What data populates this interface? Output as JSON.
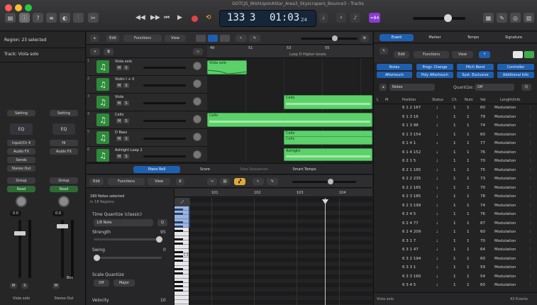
{
  "window": {
    "title": "GOTCJS_WishUponAStar_Area3_Skyscrapers_Bounce3 - Tracks"
  },
  "lcd": {
    "bar": "133",
    "beat": "3",
    "time": "01:03",
    "frames": "24"
  },
  "badge": "≈84",
  "inspector": {
    "region": "Region: 23 selected",
    "track": "Track: Viola solo",
    "strips": [
      {
        "setting": "Setting",
        "eq": "EQ",
        "input": "Input/Ch 4",
        "audiofx": "Audio FX",
        "sends": "Sends",
        "output": "Stereo Out",
        "group": "Group",
        "auto": "Read",
        "pan": "0.0",
        "name": "Viola solo"
      },
      {
        "setting": "Setting",
        "eq": "EQ",
        "input": "Hi",
        "audiofx": "Audio FX",
        "sends": "",
        "output": "",
        "group": "Group",
        "auto": "Read",
        "pan": "0.0",
        "name": "Stereo Out",
        "bnc": "Bnc"
      }
    ]
  },
  "tracks_area": {
    "menu": [
      "Edit",
      "Functions",
      "View"
    ],
    "ruler": [
      "49",
      "51",
      "53",
      "55"
    ],
    "marker": "Loop D Higher levels",
    "tracks": [
      {
        "num": "1",
        "name": "Viola solo"
      },
      {
        "num": "2",
        "name": "Violin I + II"
      },
      {
        "num": "3",
        "name": "Viola"
      },
      {
        "num": "4",
        "name": "Cello"
      },
      {
        "num": "5",
        "name": "D Bass"
      },
      {
        "num": "6",
        "name": "Ashlight Loop 2"
      }
    ],
    "regions": [
      {
        "label": "Viola solo"
      },
      {
        "label": "Cello"
      },
      {
        "label": "Cello"
      },
      {
        "label": "Cello"
      },
      {
        "label": "Cello"
      },
      {
        "label": "Ashlight"
      }
    ]
  },
  "editor_tabs": [
    "Piano Roll",
    "Score",
    "Step Sequencer",
    "Smart Tempo"
  ],
  "piano_roll": {
    "menu": [
      "Edit",
      "Functions",
      "View"
    ],
    "selected": "180 Notes selected",
    "subselected": "in 18 Regions",
    "time_quantize_label": "Time Quantize (classic)",
    "time_quantize_value": "1/8 Note",
    "strength_label": "Strength",
    "strength_value": "95",
    "swing_label": "Swing",
    "swing_value": "0",
    "scale_label": "Scale Quantize",
    "scale_off": "Off",
    "scale_major": "Major",
    "velocity_label": "Velocity",
    "velocity_value": "10",
    "ruler": [
      "101",
      "102",
      "103",
      "104"
    ],
    "key_label": "C3"
  },
  "event_list": {
    "tabs": [
      "Event",
      "Marker",
      "Tempo",
      "Signature"
    ],
    "menu": [
      "Edit",
      "Functions",
      "View"
    ],
    "filters": [
      "Notes",
      "Progr. Change",
      "Pitch Bend",
      "Controller",
      "Aftertouch",
      "Poly Aftertouch",
      "Syst. Exclusive",
      "Additional Info"
    ],
    "notes_label": "Notes",
    "quantize_label": "Quantize:",
    "quantize_value": "Off",
    "columns": [
      "L",
      "M",
      "Position",
      "Status",
      "Ch",
      "Num",
      "Val",
      "Length/Info"
    ],
    "rows": [
      {
        "pos": "6 1 2 167",
        "status": "♩",
        "ch": "1",
        "num": "1",
        "val": "60",
        "info": "Modulation"
      },
      {
        "pos": "6 1 3 16",
        "status": "♩",
        "ch": "1",
        "num": "1",
        "val": "79",
        "info": "Modulation"
      },
      {
        "pos": "6 1 3 98",
        "status": "♩",
        "ch": "1",
        "num": "1",
        "val": "74",
        "info": "Modulation"
      },
      {
        "pos": "6 1 3 154",
        "status": "♩",
        "ch": "1",
        "num": "1",
        "val": "60",
        "info": "Modulation"
      },
      {
        "pos": "6 1 4 1",
        "status": "♩",
        "ch": "1",
        "num": "1",
        "val": "77",
        "info": "Modulation"
      },
      {
        "pos": "6 1 4 152",
        "status": "♩",
        "ch": "1",
        "num": "1",
        "val": "76",
        "info": "Modulation"
      },
      {
        "pos": "6 2 1 5",
        "status": "♩",
        "ch": "1",
        "num": "1",
        "val": "70",
        "info": "Modulation"
      },
      {
        "pos": "6 2 1 165",
        "status": "♩",
        "ch": "1",
        "num": "1",
        "val": "75",
        "info": "Modulation"
      },
      {
        "pos": "6 2 2 235",
        "status": "♩",
        "ch": "1",
        "num": "1",
        "val": "73",
        "info": "Modulation"
      },
      {
        "pos": "6 2 2 165",
        "status": "♩",
        "ch": "1",
        "num": "1",
        "val": "70",
        "info": "Modulation"
      },
      {
        "pos": "6 2 3 185",
        "status": "♩",
        "ch": "1",
        "num": "1",
        "val": "78",
        "info": "Modulation"
      },
      {
        "pos": "6 2 3 199",
        "status": "♩",
        "ch": "1",
        "num": "1",
        "val": "74",
        "info": "Modulation"
      },
      {
        "pos": "6 2 4 5",
        "status": "♩",
        "ch": "1",
        "num": "1",
        "val": "76",
        "info": "Modulation"
      },
      {
        "pos": "6 2 4 77",
        "status": "♩",
        "ch": "1",
        "num": "1",
        "val": "67",
        "info": "Modulation"
      },
      {
        "pos": "6 2 4 209",
        "status": "♩",
        "ch": "1",
        "num": "1",
        "val": "60",
        "info": "Modulation"
      },
      {
        "pos": "6 3 1 7",
        "status": "♩",
        "ch": "1",
        "num": "1",
        "val": "70",
        "info": "Modulation"
      },
      {
        "pos": "6 3 1 47",
        "status": "♩",
        "ch": "1",
        "num": "1",
        "val": "64",
        "info": "Modulation"
      },
      {
        "pos": "6 3 2 194",
        "status": "♩",
        "ch": "1",
        "num": "1",
        "val": "60",
        "info": "Modulation"
      },
      {
        "pos": "6 3 3 1",
        "status": "♩",
        "ch": "1",
        "num": "1",
        "val": "59",
        "info": "Modulation"
      },
      {
        "pos": "6 3 3 160",
        "status": "♩",
        "ch": "1",
        "num": "1",
        "val": "54",
        "info": "Modulation"
      },
      {
        "pos": "6 3 4 5",
        "status": "♩",
        "ch": "1",
        "num": "1",
        "val": "60",
        "info": "Modulation"
      }
    ],
    "footer_left": "Viola solo",
    "footer_right": "43 Events"
  },
  "colors": {
    "accent": "#1f5fb0",
    "region": "#5cd16a",
    "badge": "#8a3bd1",
    "record": "#e04545"
  }
}
